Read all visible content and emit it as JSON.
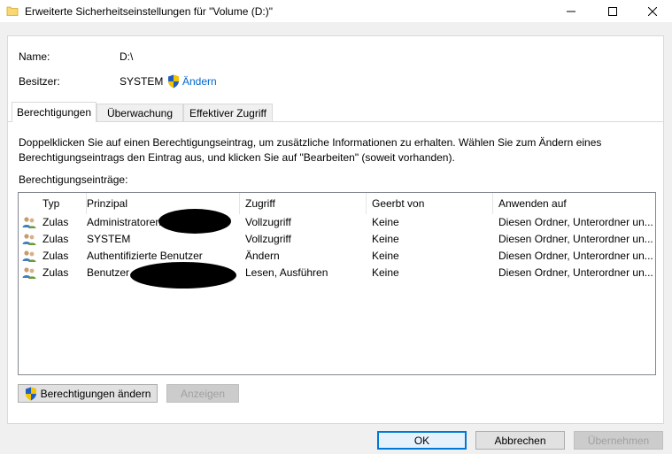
{
  "window": {
    "title": "Erweiterte Sicherheitseinstellungen für \"Volume (D:)\""
  },
  "info": {
    "name_label": "Name:",
    "name_value": "D:\\",
    "owner_label": "Besitzer:",
    "owner_value": "SYSTEM",
    "owner_change_link": "Ändern"
  },
  "tabs": [
    {
      "label": "Berechtigungen",
      "active": true
    },
    {
      "label": "Überwachung",
      "active": false
    },
    {
      "label": "Effektiver Zugriff",
      "active": false
    }
  ],
  "description": "Doppelklicken Sie auf einen Berechtigungseintrag, um zusätzliche Informationen zu erhalten. Wählen Sie zum Ändern eines Berechtigungseintrags den Eintrag aus, und klicken Sie auf \"Bearbeiten\" (soweit vorhanden).",
  "entries_label": "Berechtigungseinträge:",
  "table": {
    "columns": [
      "Typ",
      "Prinzipal",
      "Zugriff",
      "Geerbt von",
      "Anwenden auf"
    ],
    "rows": [
      {
        "typ": "Zulas",
        "prinzipal": "Administratoren",
        "zugriff": "Vollzugriff",
        "geerbt": "Keine",
        "anwenden": "Diesen Ordner, Unterordner un..."
      },
      {
        "typ": "Zulas",
        "prinzipal": "SYSTEM",
        "zugriff": "Vollzugriff",
        "geerbt": "Keine",
        "anwenden": "Diesen Ordner, Unterordner un..."
      },
      {
        "typ": "Zulas",
        "prinzipal": "Authentifizierte Benutzer",
        "zugriff": "Ändern",
        "geerbt": "Keine",
        "anwenden": "Diesen Ordner, Unterordner un..."
      },
      {
        "typ": "Zulas",
        "prinzipal": "Benutzer",
        "zugriff": "Lesen, Ausführen",
        "geerbt": "Keine",
        "anwenden": "Diesen Ordner, Unterordner un..."
      }
    ]
  },
  "buttons": {
    "change_permissions": "Berechtigungen ändern",
    "show": "Anzeigen",
    "ok": "OK",
    "cancel": "Abbrechen",
    "apply": "Übernehmen"
  },
  "colors": {
    "link": "#0066cc",
    "default_button_border": "#0078d7",
    "shield_blue": "#1f5fbf",
    "shield_yellow": "#f5c400"
  }
}
